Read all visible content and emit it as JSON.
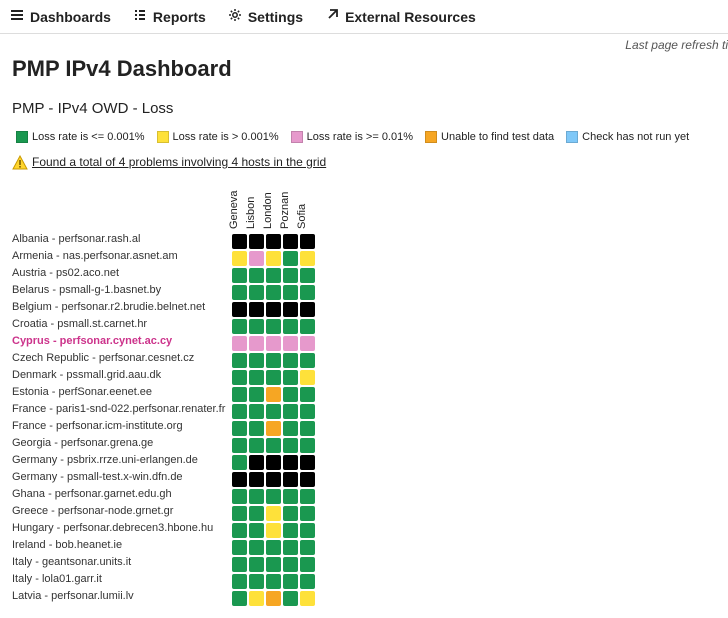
{
  "nav": {
    "dashboards": "Dashboards",
    "reports": "Reports",
    "settings": "Settings",
    "external": "External Resources"
  },
  "refresh_partial": "Last page refresh ti",
  "page_title": "PMP IPv4 Dashboard",
  "section_title": "PMP - IPv4 OWD - Loss",
  "legend": {
    "ok": {
      "label": "Loss rate is <= 0.001%",
      "color": "#1a9850"
    },
    "warn": {
      "label": "Loss rate is > 0.001%",
      "color": "#fee13a"
    },
    "bad": {
      "label": "Loss rate is >= 0.01%",
      "color": "#e699cc"
    },
    "nodata": {
      "label": "Unable to find test data",
      "color": "#f6a623"
    },
    "notrun": {
      "label": "Check has not run yet",
      "color": "#7fc8f8"
    }
  },
  "problems_text": "Found a total of 4 problems involving 4 hosts in the grid",
  "columns": [
    "Geneva",
    "Lisbon",
    "London",
    "Poznan",
    "Sofia"
  ],
  "rows": [
    {
      "label": "Albania - perfsonar.rash.al",
      "cells": [
        "k",
        "k",
        "k",
        "k",
        "k"
      ]
    },
    {
      "label": "Armenia - nas.perfsonar.asnet.am",
      "cells": [
        "y",
        "p",
        "y",
        "g",
        "y"
      ]
    },
    {
      "label": "Austria - ps02.aco.net",
      "cells": [
        "g",
        "g",
        "g",
        "g",
        "g"
      ]
    },
    {
      "label": "Belarus - psmall-g-1.basnet.by",
      "cells": [
        "g",
        "g",
        "g",
        "g",
        "g"
      ]
    },
    {
      "label": "Belgium - perfsonar.r2.brudie.belnet.net",
      "cells": [
        "k",
        "k",
        "k",
        "k",
        "k"
      ]
    },
    {
      "label": "Croatia - psmall.st.carnet.hr",
      "cells": [
        "g",
        "g",
        "g",
        "g",
        "g"
      ]
    },
    {
      "label": "Cyprus - perfsonar.cynet.ac.cy",
      "cells": [
        "p",
        "p",
        "p",
        "p",
        "p"
      ],
      "highlight": true
    },
    {
      "label": "Czech Republic - perfsonar.cesnet.cz",
      "cells": [
        "g",
        "g",
        "g",
        "g",
        "g"
      ]
    },
    {
      "label": "Denmark - pssmall.grid.aau.dk",
      "cells": [
        "g",
        "g",
        "g",
        "g",
        "y"
      ]
    },
    {
      "label": "Estonia - perfSonar.eenet.ee",
      "cells": [
        "g",
        "g",
        "o",
        "g",
        "g"
      ]
    },
    {
      "label": "France - paris1-snd-022.perfsonar.renater.fr",
      "cells": [
        "g",
        "g",
        "g",
        "g",
        "g"
      ]
    },
    {
      "label": "France - perfsonar.icm-institute.org",
      "cells": [
        "g",
        "g",
        "o",
        "g",
        "g"
      ]
    },
    {
      "label": "Georgia - perfsonar.grena.ge",
      "cells": [
        "g",
        "g",
        "g",
        "g",
        "g"
      ]
    },
    {
      "label": "Germany - psbrix.rrze.uni-erlangen.de",
      "cells": [
        "g",
        "k",
        "k",
        "k",
        "k"
      ]
    },
    {
      "label": "Germany - psmall-test.x-win.dfn.de",
      "cells": [
        "k",
        "k",
        "k",
        "k",
        "k"
      ]
    },
    {
      "label": "Ghana - perfsonar.garnet.edu.gh",
      "cells": [
        "g",
        "g",
        "g",
        "g",
        "g"
      ]
    },
    {
      "label": "Greece - perfsonar-node.grnet.gr",
      "cells": [
        "g",
        "g",
        "y",
        "g",
        "g"
      ]
    },
    {
      "label": "Hungary - perfsonar.debrecen3.hbone.hu",
      "cells": [
        "g",
        "g",
        "y",
        "g",
        "g"
      ]
    },
    {
      "label": "Ireland - bob.heanet.ie",
      "cells": [
        "g",
        "g",
        "g",
        "g",
        "g"
      ]
    },
    {
      "label": "Italy - geantsonar.units.it",
      "cells": [
        "g",
        "g",
        "g",
        "g",
        "g"
      ]
    },
    {
      "label": "Italy - lola01.garr.it",
      "cells": [
        "g",
        "g",
        "g",
        "g",
        "g"
      ]
    },
    {
      "label": "Latvia - perfsonar.lumii.lv",
      "cells": [
        "g",
        "y",
        "o",
        "g",
        "y"
      ]
    }
  ]
}
